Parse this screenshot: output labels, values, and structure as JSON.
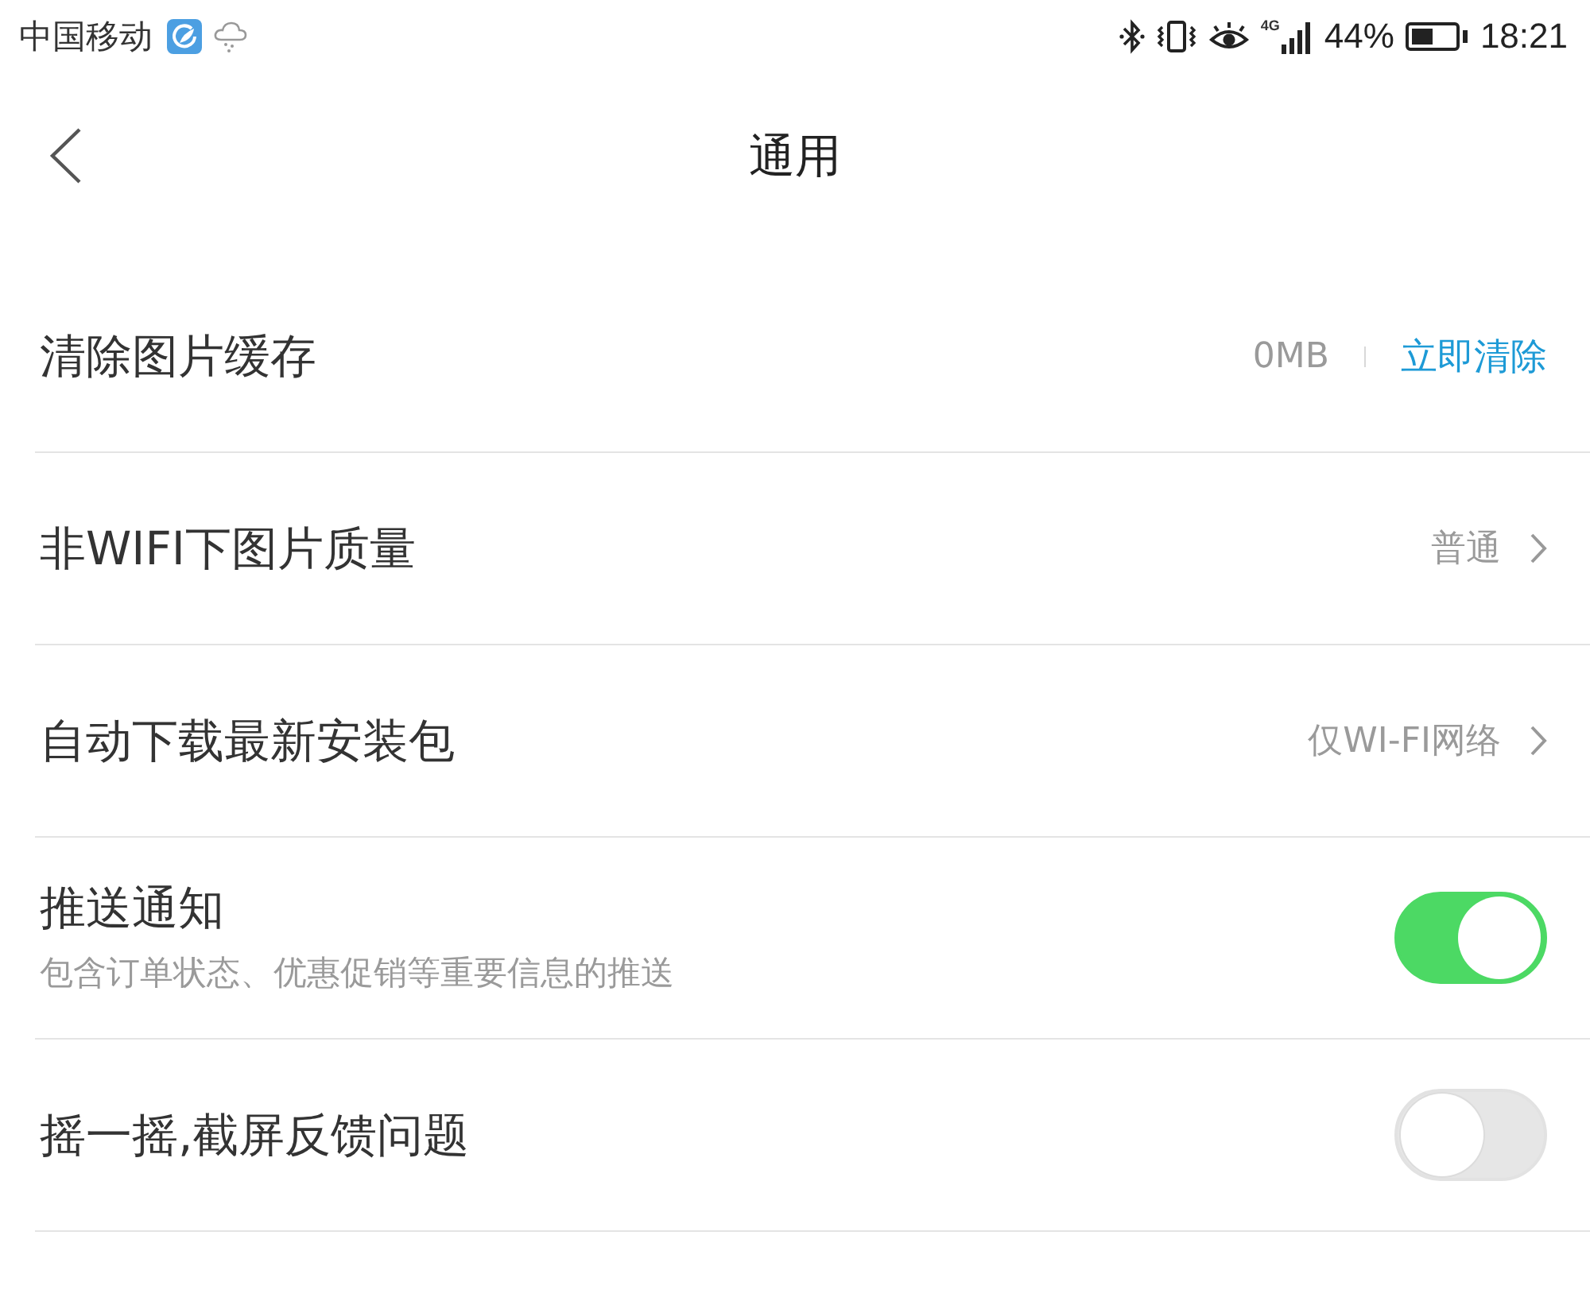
{
  "status_bar": {
    "carrier": "中国移动",
    "network": "4G",
    "battery": "44%",
    "time": "18:21"
  },
  "nav": {
    "title": "通用"
  },
  "settings": [
    {
      "kind": "action",
      "title": "清除图片缓存",
      "value": "0MB",
      "action": "立即清除"
    },
    {
      "kind": "link",
      "title": "非WIFI下图片质量",
      "value": "普通"
    },
    {
      "kind": "link",
      "title": "自动下载最新安装包",
      "value": "仅WI-FI网络"
    },
    {
      "kind": "toggle",
      "title": "推送通知",
      "subtitle": "包含订单状态、优惠促销等重要信息的推送",
      "on": true
    },
    {
      "kind": "toggle",
      "title": "摇一摇,截屏反馈问题",
      "on": false
    }
  ]
}
